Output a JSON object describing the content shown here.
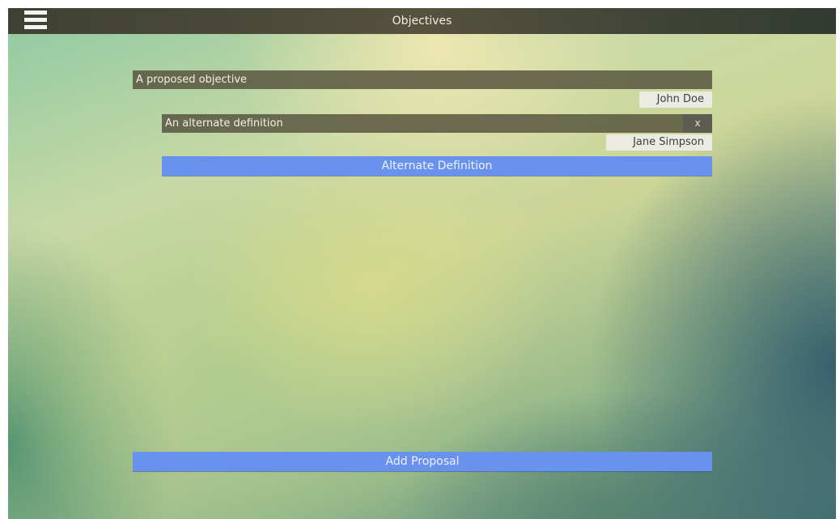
{
  "header": {
    "title": "Objectives",
    "menu_icon": "hamburger-menu-icon"
  },
  "proposal": {
    "objective_text": "A proposed objective",
    "author": "John Doe",
    "alternate": {
      "text": "An alternate definition",
      "remove_label": "x",
      "author": "Jane Simpson"
    },
    "alternate_button_label": "Alternate Definition"
  },
  "footer": {
    "add_proposal_label": "Add Proposal"
  },
  "colors": {
    "button_blue": "#6992ee",
    "bar_dark": "#58563e",
    "topbar": "#3a382c"
  }
}
